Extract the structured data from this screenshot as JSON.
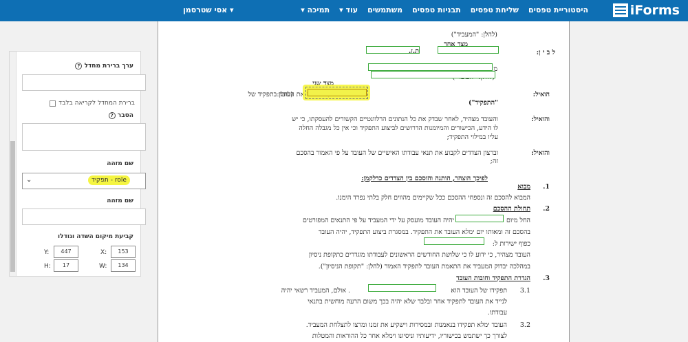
{
  "header": {
    "user_label": "▾ אסי שטרסמן",
    "logo_text": "iForms",
    "nav": [
      "היסטוריית טפסים",
      "שליחת טפסים",
      "תבניות טפסים",
      "משתמשים",
      "▾ עוד",
      "▾ תמיכה"
    ]
  },
  "panel": {
    "default_value_label": "ערך ברירת מחדל",
    "readonly_checkbox_label": "ברירת המחדל לקריאה בלבד",
    "explanation_label": "הסבר",
    "identifier_label_1": "שם מזהה",
    "identifier_value": "תפקיד - role",
    "identifier_label_2": "שם מזהה",
    "position_label": "קביעת מיקום השדה וגודלו",
    "coords": {
      "x_label": "X:",
      "x": "153",
      "y_label": "Y:",
      "y": "447",
      "w_label": "W:",
      "w": "134",
      "h_label": "H:",
      "h": "17"
    }
  },
  "document": {
    "lines": {
      "employer_label": "(להלן: \"המעביד\")",
      "side_one": "מצד אחד",
      "between": "ל ב י ן:",
      "id_label": "ת.ז.",
      "mem": "מ",
      "employee_label": "(להלן: \"העובד\")",
      "side_two": "מצד שני",
      "whereas1_title": "הואיל:",
      "whereas1_a": "והמעביד מעוניין להעסיק את העובד בתפקיד של",
      "whereas1_b": "(להלן:",
      "whereas1_c": "\"התפקיד\")",
      "whereas2_title": "והואיל:",
      "whereas2_a": "והעובד מצהיר, לאחר שבדק את כל הנתונים הרלוונטיים הקשורים להעסקתו, כי יש",
      "whereas2_b": "לו הידע, הכישורים והמיומנות הדרושים לביצוע התפקיד וכי אין כל מגבלה החלה",
      "whereas2_c": "עליו במילוי התפקיד;",
      "whereas3_title": "והואיל:",
      "whereas3_a": "וברצון הצדדים לקבוע את תנאי עבודתו האישיים של העובד על פי האמור בהסכם",
      "whereas3_b": "זה;",
      "declared": "לפיכך הוצהר, הותנה והוסכם בין הצדדים כדלקמן:",
      "s1_num": "1.",
      "s1_title": "מבוא",
      "s1_text": "המבוא להסכם זה ונספחי ההסכם ככל שקיימים מהווים חלק בלתי נפרד הימנו.",
      "s2_num": "2.",
      "s2_title": "תחולת ההסכם",
      "s2_a1": "החל מיום",
      "s2_a2": "יהיה העובד מועסק על ידי המעביד על פי התנאים המפורטים",
      "s2_b": "בהסכם זה ומאותו יום ימלא העובד את התפקיד.  במסגרת ביצוע התפקיד, יהיה העובד",
      "s2_c": "כפוף ישירות ל:",
      "s2_d": "העובד מצהיר, כי ידוע לו כי שלושת החודשים הראשונים לעבודתו מוגדרים כתקופת ניסיון",
      "s2_e": "במהלכה יבדוק המעביד את התאמת העובד לתפקיד האמור (להלן: \"תקופת הניסיון\").",
      "s3_num": "3.",
      "s3_title": "הגדרת התפקיד וחובות העובד",
      "s31_num": "3.1",
      "s31_a1": "תפקידו של העובד הוא",
      "s31_a2": ". אולם, המעביד רשאי יהיה",
      "s31_b": "לנייד את העובד לתפקיד אחר ובלבד שלא יהיה בכך משום הרעה מוחשית בתנאי",
      "s31_c": "עבודתו.",
      "s32_num": "3.2",
      "s32_a": "העובד ימלא תפקידו בנאמנות ובמסירות וישקיע את זמנו ומרצו לתצלחת המעביד.",
      "s32_b": "לצורך כך ישתמש בכישוריו, ידיעותיו וניסיונו וימלא אחר כל ההוראות והמטלות"
    }
  }
}
